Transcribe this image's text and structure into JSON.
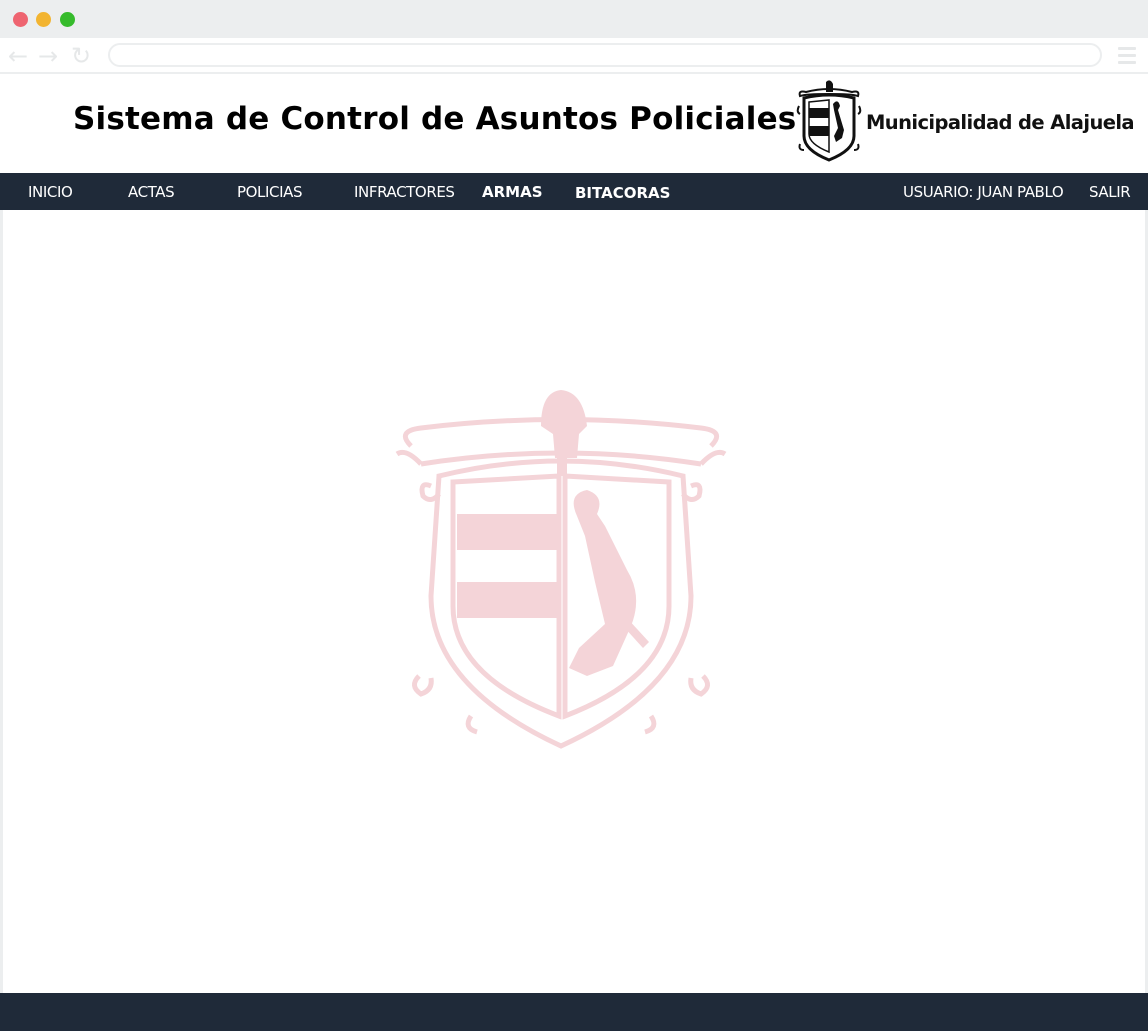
{
  "browser": {
    "back_glyph": "←",
    "forward_glyph": "→",
    "reload_glyph": "↻",
    "address": "",
    "icons": [
      "back-arrow-icon",
      "forward-arrow-icon",
      "reload-icon",
      "hamburger-menu-icon"
    ]
  },
  "header": {
    "title": "Sistema de Control de Asuntos Policiales",
    "logo_text": "Municipalidad de Alajuela",
    "logo_icon": "coat-of-arms-icon"
  },
  "nav": {
    "inicio": "INICIO",
    "actas": "ACTAS",
    "policias": "POLICIAS",
    "infractores": "INFRACTORES",
    "armas": "ARMAS",
    "bitacoras": "BITACORAS",
    "usuario": "USUARIO: JUAN PABLO",
    "salir": "SALIR"
  },
  "colors": {
    "navbar": "#1f2a39",
    "footer": "#1f2a39",
    "watermark": "#f4d4d8",
    "traffic_red": "#ee6470",
    "traffic_yellow": "#f2b431",
    "traffic_green": "#36bb2c"
  }
}
